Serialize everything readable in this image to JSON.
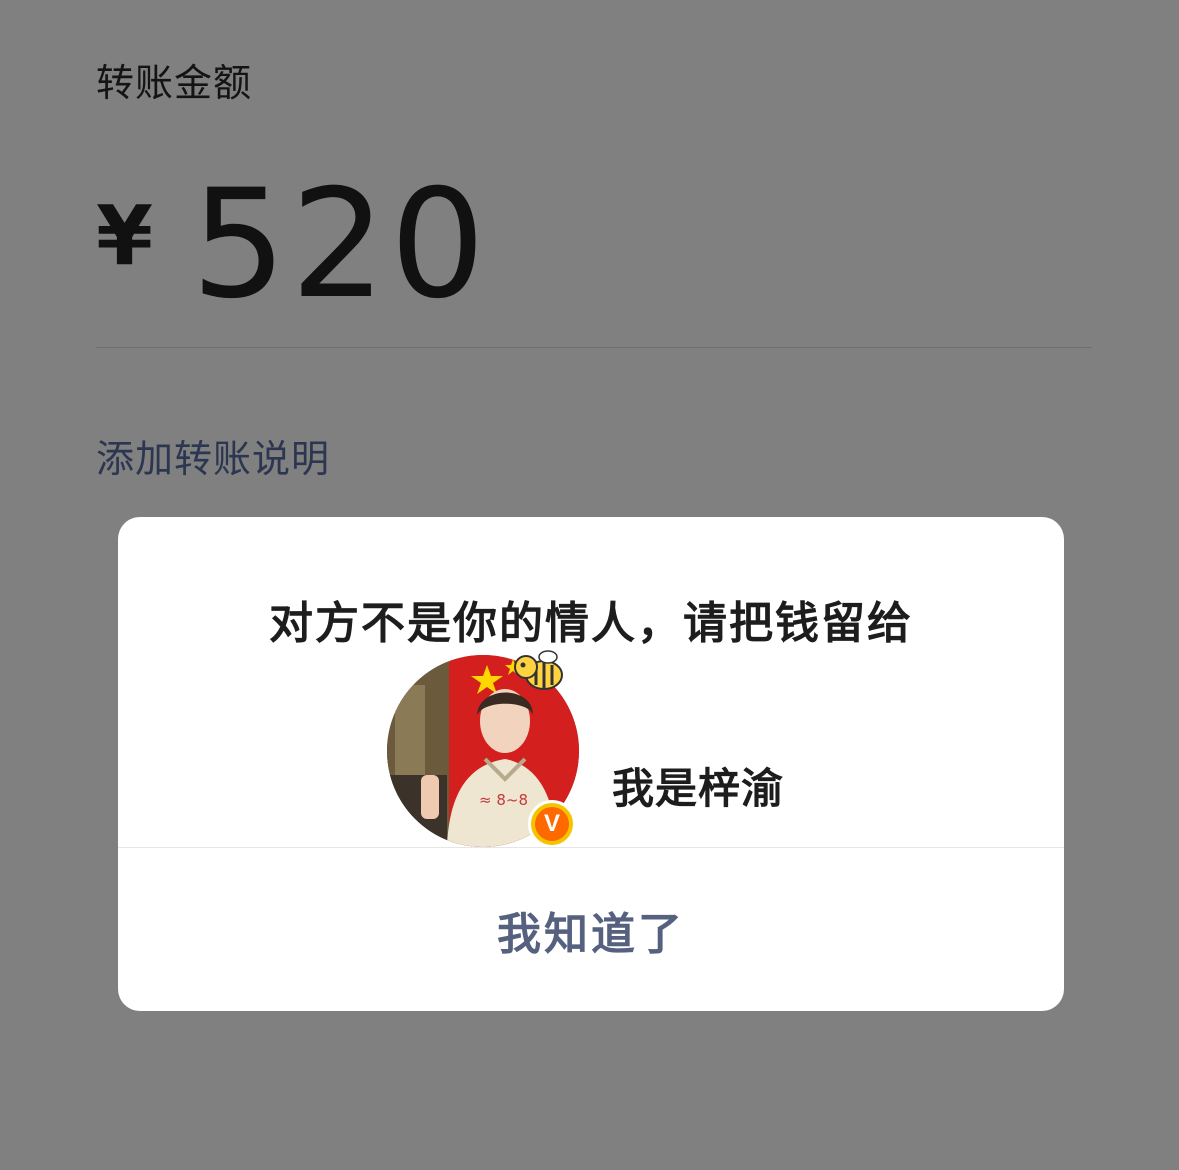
{
  "transfer": {
    "amount_label": "转账金额",
    "currency_symbol": "¥",
    "amount": "520",
    "add_note_link": "添加转账说明"
  },
  "dialog": {
    "message": "对方不是你的情人，请把钱留给",
    "account_name": "我是梓渝",
    "verified_badge": "V",
    "confirm_button": "我知道了"
  },
  "colors": {
    "overlay_background": "#808080",
    "dialog_background": "#ffffff",
    "link_text": "#2d3651",
    "confirm_text": "#55617f",
    "badge_yellow": "#f5c400",
    "badge_orange": "#ff6a00"
  },
  "icons": {
    "avatar": "profile-photo",
    "badge": "verified-v-icon",
    "sticker": "bee-icon"
  }
}
